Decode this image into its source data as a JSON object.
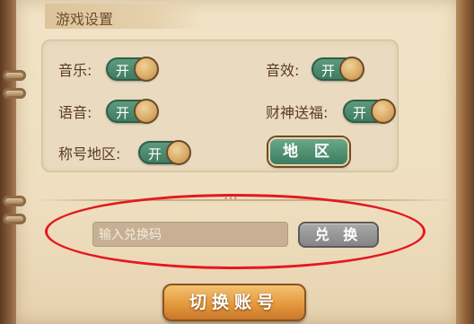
{
  "section": {
    "title": "游戏设置"
  },
  "settings": {
    "music": {
      "label": "音乐:",
      "state": "开"
    },
    "sound_fx": {
      "label": "音效:",
      "state": "开"
    },
    "voice": {
      "label": "语音:",
      "state": "开"
    },
    "fortune": {
      "label": "财神送福:",
      "state": "开"
    },
    "title_region": {
      "label": "称号地区:",
      "state": "开"
    },
    "region_button": "地 区"
  },
  "redeem": {
    "placeholder": "输入兑换码",
    "button": "兑 换"
  },
  "switch_account": "切换账号",
  "colors": {
    "toggle_on": "#3f7c61",
    "knob": "#d8a964",
    "highlight_ellipse": "#e3191f",
    "switch_button": "#e49a3d"
  }
}
